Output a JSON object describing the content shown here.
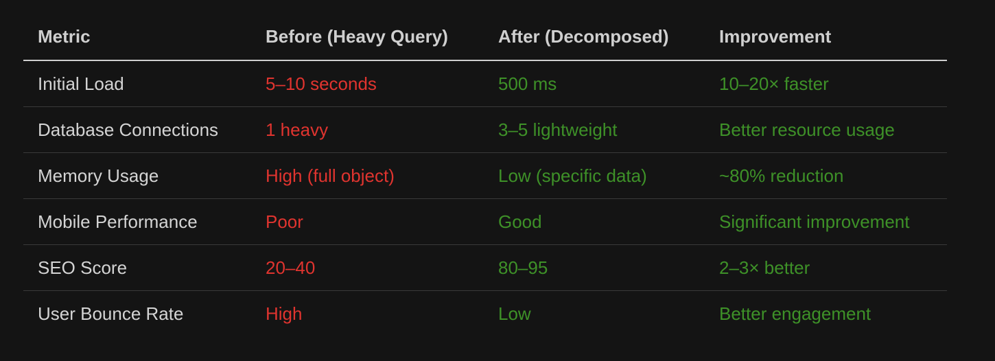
{
  "colors": {
    "background": "#141414",
    "header_text": "#cfcfcf",
    "metric_text": "#d4d4d4",
    "before_text": "#e0342f",
    "after_text": "#3e9128",
    "improvement_text": "#3e9128"
  },
  "table": {
    "headers": [
      "Metric",
      "Before (Heavy Query)",
      "After (Decomposed)",
      "Improvement"
    ],
    "rows": [
      [
        "Initial Load",
        "5–10 seconds",
        "500 ms",
        "10–20× faster"
      ],
      [
        "Database Connections",
        "1 heavy",
        "3–5 lightweight",
        "Better resource usage"
      ],
      [
        "Memory Usage",
        "High (full object)",
        "Low (specific data)",
        "~80% reduction"
      ],
      [
        "Mobile Performance",
        "Poor",
        "Good",
        "Significant improvement"
      ],
      [
        "SEO Score",
        "20–40",
        "80–95",
        "2–3× better"
      ],
      [
        "User Bounce Rate",
        "High",
        "Low",
        "Better engagement"
      ]
    ]
  }
}
